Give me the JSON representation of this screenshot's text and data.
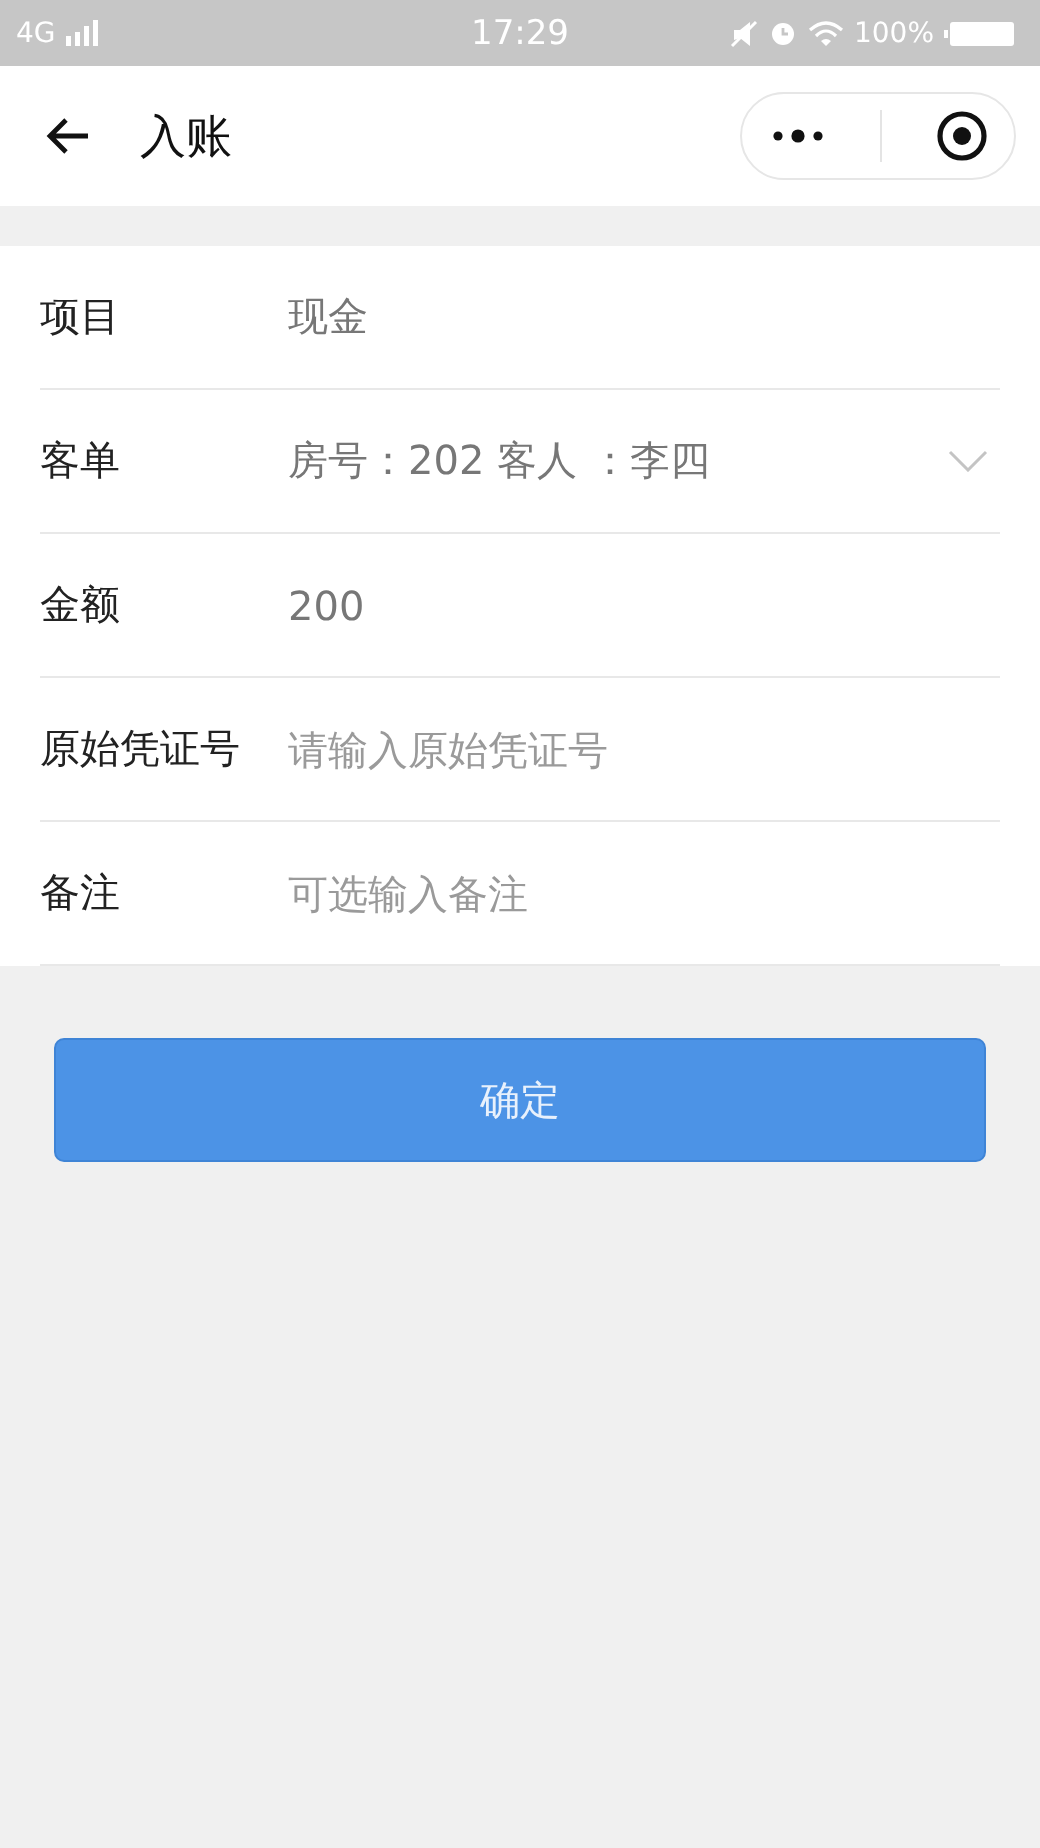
{
  "status_bar": {
    "network": "4G",
    "time": "17:29",
    "battery": "100%"
  },
  "header": {
    "title": "入账"
  },
  "fields": [
    {
      "kind": "input",
      "label": "项目",
      "value": "现金"
    },
    {
      "kind": "select",
      "label": "客单",
      "value": "房号：202 客人 ：李四"
    },
    {
      "kind": "input",
      "label": "金额",
      "value": "200"
    },
    {
      "kind": "input",
      "label": "原始凭证号",
      "placeholder": "请输入原始凭证号"
    },
    {
      "kind": "input",
      "label": "备注",
      "placeholder": "可选输入备注"
    }
  ],
  "submit_button": "确定"
}
